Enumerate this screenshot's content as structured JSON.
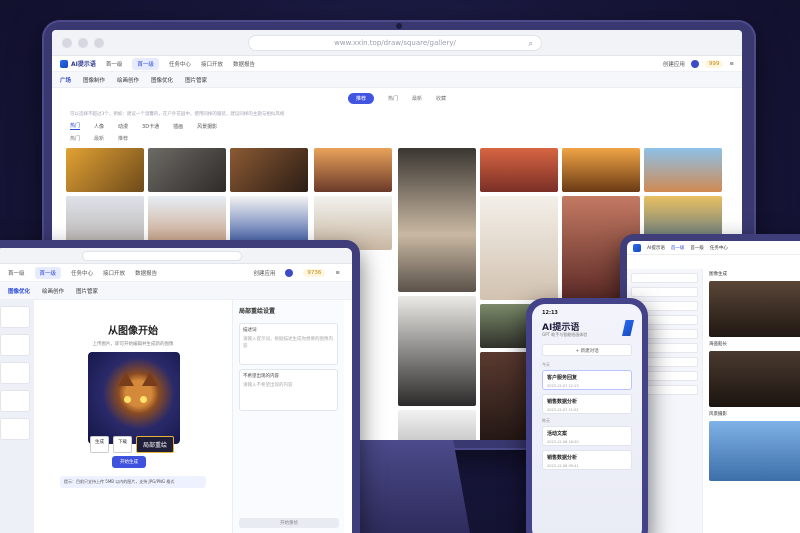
{
  "laptop": {
    "url": "www.xxin.top/draw/square/gallery/",
    "brand": "AI提示语",
    "nav": [
      "首一级",
      "首一级",
      "任务中心",
      "接口开放",
      "数据报告"
    ],
    "nav_active": 1,
    "nav_right": {
      "label": "创建应用",
      "coins": "999"
    },
    "tools": [
      "广场",
      "图像制作",
      "绘画创作",
      "图像优化",
      "图片管家"
    ],
    "tools_active": 0,
    "segments": [
      "推荐",
      "热门",
      "最新",
      "收藏"
    ],
    "segments_active": 0,
    "search_hint": "可以选择不超过3个，例如：建议一个温馨的，在户外花园中，使用同样的服装，建议同样的主题与相似风格",
    "filters": [
      "热门",
      "人像",
      "动漫",
      "3D卡通",
      "插画",
      "风景摄影"
    ],
    "filters_active": 0,
    "sort": [
      "热门",
      "最新",
      "推荐"
    ]
  },
  "tablet": {
    "nav": [
      "首一级",
      "首一级",
      "任务中心",
      "接口开放",
      "数据报告"
    ],
    "nav_active": 1,
    "nav_right": {
      "label": "创建应用",
      "coins": "9736"
    },
    "tools": [
      "图像优化",
      "绘画创作",
      "图片管家"
    ],
    "tools_active": 0,
    "title": "从图像开始",
    "subtitle": "上传图片，即可开始编辑并生成新的图像",
    "art_buttons": [
      "生成",
      "下载"
    ],
    "art_primary": "局部重绘",
    "generate": "开始生成",
    "tip": "提示：目前只支持上传 5MB 以内的图片，支持 JPG/PNG 格式",
    "panel_title": "局部重绘设置",
    "prompt_label": "描述词",
    "prompt_placeholder": "请输入提示词，根据描述生成你想要的图像内容",
    "neg_label": "不希望出现的内容",
    "neg_placeholder": "请输入不希望出现的内容",
    "footer_btn": "开始重绘"
  },
  "right_tablet": {
    "nav": [
      "AI提示语",
      "首一级",
      "首一级",
      "任务中心"
    ],
    "labels": [
      "图像生成",
      "海盗船长",
      "风景摄影"
    ]
  },
  "phone": {
    "time": "12:13",
    "title": "AI提示语",
    "subtitle": "GPT 助手与智能绘画体验",
    "new_chat": "+ 新建对话",
    "groups": [
      "今天",
      "昨天"
    ],
    "cards": [
      {
        "title": "客户服务回复",
        "meta": "2023-12-07 12:13"
      },
      {
        "title": "销售数据分析",
        "meta": "2023-12-07 11:02"
      },
      {
        "title": "活动文案",
        "meta": "2023-12-06 18:20"
      },
      {
        "title": "销售数据分析",
        "meta": "2023-12-06 09:41"
      }
    ]
  },
  "colors": {
    "accent": "#4155e0",
    "bg": "#17163a",
    "device": "#3f3d7a"
  }
}
